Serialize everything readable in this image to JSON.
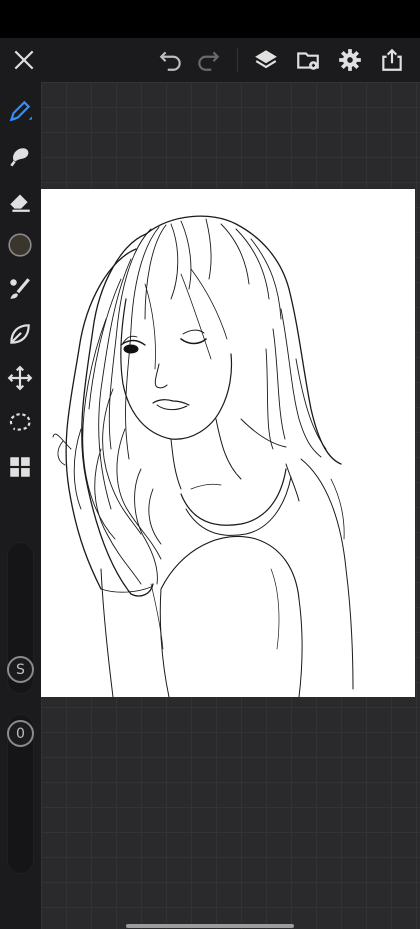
{
  "app": {
    "accent_color": "#2f8fff",
    "icon_color": "#d9d9d9"
  },
  "top_bar": {
    "buttons": [
      "close-icon",
      "undo-icon",
      "redo-icon",
      "layers-icon",
      "gallery-import-icon",
      "settings-gear-icon",
      "share-export-icon"
    ]
  },
  "toolbar": {
    "tools": [
      "brush-pen-icon",
      "smudge-icon",
      "eraser-icon",
      "color-swatch",
      "brush-settings-icon",
      "shape-leaf-icon",
      "transform-move-icon",
      "lasso-select-icon",
      "grid-apps-icon"
    ],
    "current_color": "#3b362d",
    "size_label": "S",
    "opacity_label": "0"
  },
  "canvas": {
    "subject": "line-art-portrait"
  }
}
